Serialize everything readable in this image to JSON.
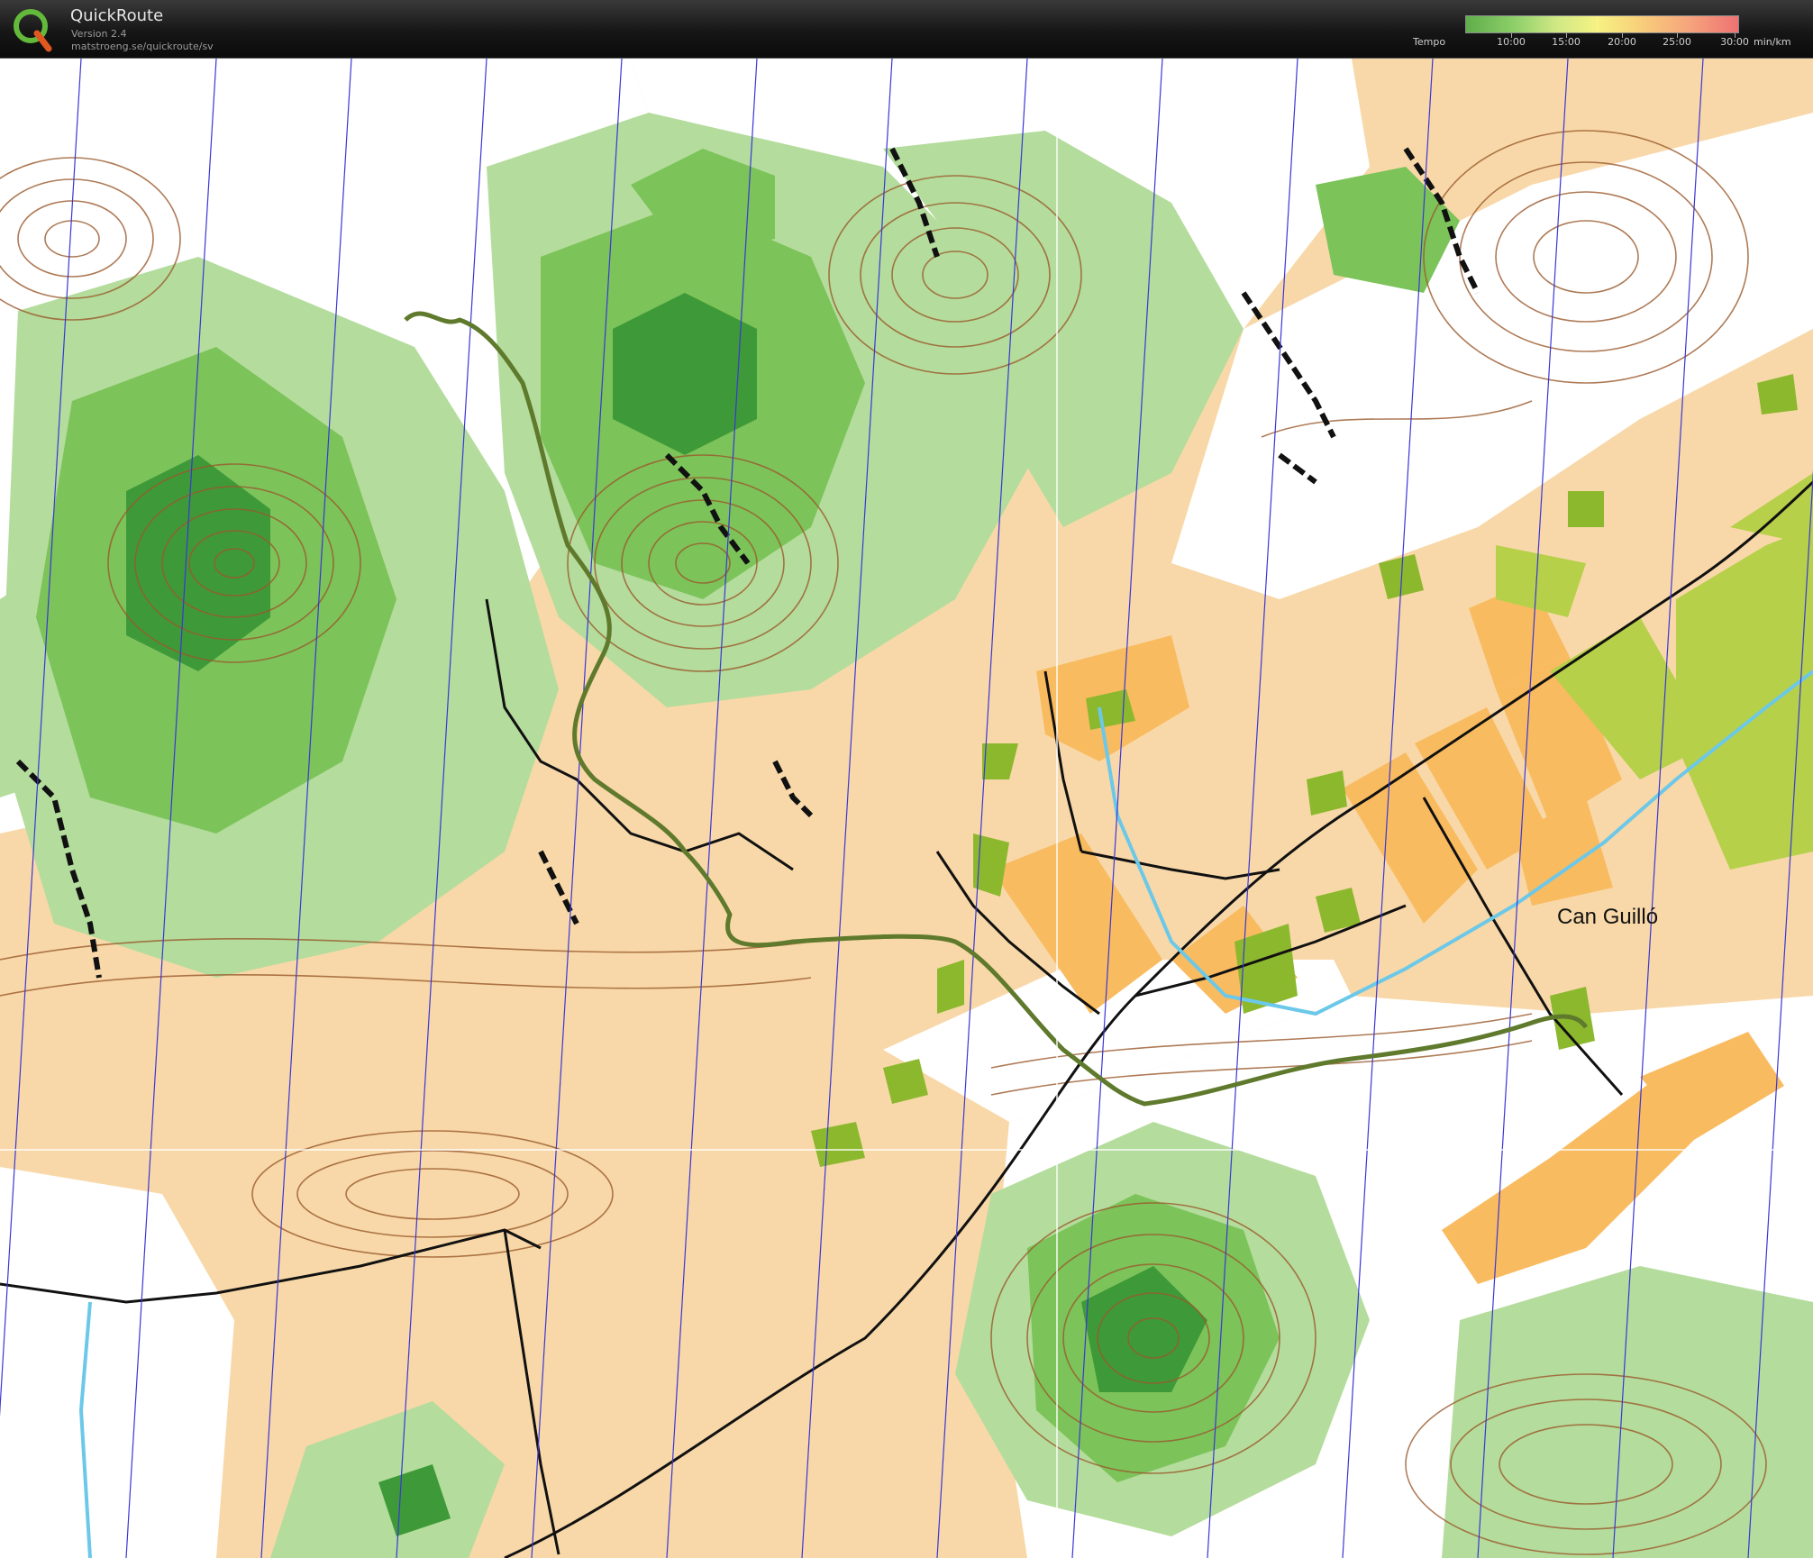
{
  "app": {
    "name": "QuickRoute",
    "version": "Version 2.4",
    "url": "matstroeng.se/quickroute/sv",
    "logo_letter": "Q"
  },
  "legend": {
    "label": "Tempo",
    "ticks": [
      "10:00",
      "15:00",
      "20:00",
      "25:00",
      "30:00"
    ],
    "unit": "min/km"
  },
  "map": {
    "place_label": "Can Guilló",
    "colors": {
      "open_land": "#f8d8a8",
      "rough_open": "#f9bb60",
      "white_forest": "#ffffff",
      "green_light": "#b4dc9c",
      "green_mid": "#7cc35a",
      "green_dark": "#3e9a38",
      "contour": "#9a5a2c",
      "rock": "#111111",
      "route": "#5f7a2c",
      "olive": "#8cb82e",
      "magnetic_line": "#3a37d6",
      "water": "#6cc8e8"
    }
  }
}
